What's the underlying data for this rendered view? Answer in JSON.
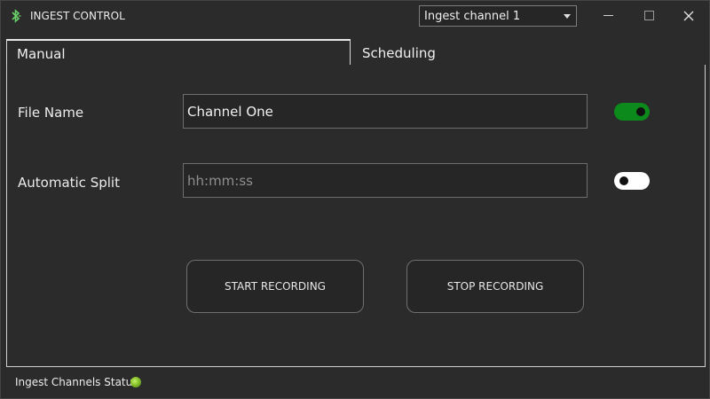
{
  "window": {
    "title": "INGEST CONTROL",
    "channel_select": {
      "value": "Ingest channel 1"
    }
  },
  "tabs": [
    {
      "label": "Manual",
      "selected": true
    },
    {
      "label": "Scheduling",
      "selected": false
    }
  ],
  "form": {
    "file_name": {
      "label": "File Name",
      "value": "Channel One",
      "toggle_on": true
    },
    "automatic_split": {
      "label": "Automatic Split",
      "value": "",
      "placeholder": "hh:mm:ss",
      "toggle_on": false
    }
  },
  "buttons": {
    "start_label": "START RECORDING",
    "stop_label": "STOP RECORDING"
  },
  "status": {
    "label": "Ingest Channels Status",
    "indicator_color": "#86c12a"
  },
  "colors": {
    "background": "#2b2b2b",
    "toggle_on": "#0d8a1c",
    "toggle_off": "#ffffff",
    "app_icon": "#6ad16a"
  },
  "icons": {
    "app": "bluetooth-like-logo-icon",
    "minimize": "minimize-icon",
    "maximize": "maximize-icon",
    "close": "close-icon",
    "dropdown": "chevron-down-icon"
  }
}
